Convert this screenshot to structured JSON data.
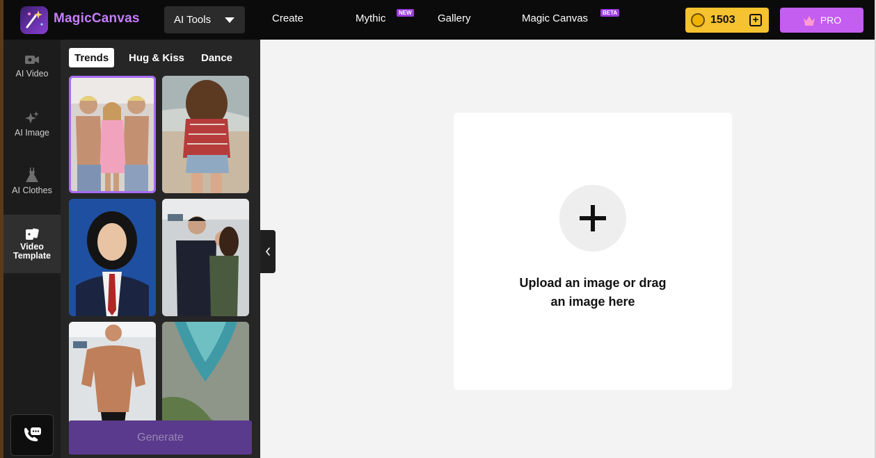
{
  "app": {
    "name": "MagicCanvas"
  },
  "header": {
    "tools_label": "AI Tools",
    "nav": [
      {
        "label": "Create",
        "tag": ""
      },
      {
        "label": "Mythic",
        "tag": "NEW"
      },
      {
        "label": "Gallery",
        "tag": ""
      },
      {
        "label": "Magic Canvas",
        "tag": "BETA"
      }
    ],
    "coins": "1503",
    "coin_add_label": "+",
    "pro_label": "PRO"
  },
  "sidebar": {
    "items": [
      {
        "label": "AI Video",
        "icon": "video-camera-icon"
      },
      {
        "label": "AI Image",
        "icon": "sparkle-icon"
      },
      {
        "label": "AI Clothes",
        "icon": "dress-icon"
      },
      {
        "label": "Video Template",
        "icon": "cards-icon",
        "active": true
      }
    ],
    "support_icon": "phone-chat-icon"
  },
  "templates": {
    "tabs": [
      {
        "label": "Trends",
        "active": true
      },
      {
        "label": "Hug & Kiss"
      },
      {
        "label": "Dance"
      }
    ],
    "thumbnails": [
      {
        "name": "template-group-hug",
        "selected": true
      },
      {
        "name": "template-beach-walk"
      },
      {
        "name": "template-portrait"
      },
      {
        "name": "template-couple-airport"
      },
      {
        "name": "template-bodybuilder"
      },
      {
        "name": "template-aerial-lake"
      }
    ],
    "generate_label": "Generate"
  },
  "upload": {
    "line1": "Upload an image or drag",
    "line2": "an image here"
  },
  "colors": {
    "brand": "#c77dff",
    "coin_bg": "#f5c230",
    "pro_bg": "#c45ef0",
    "generate_bg": "#5a3a8c",
    "selection": "#a66bf0"
  }
}
